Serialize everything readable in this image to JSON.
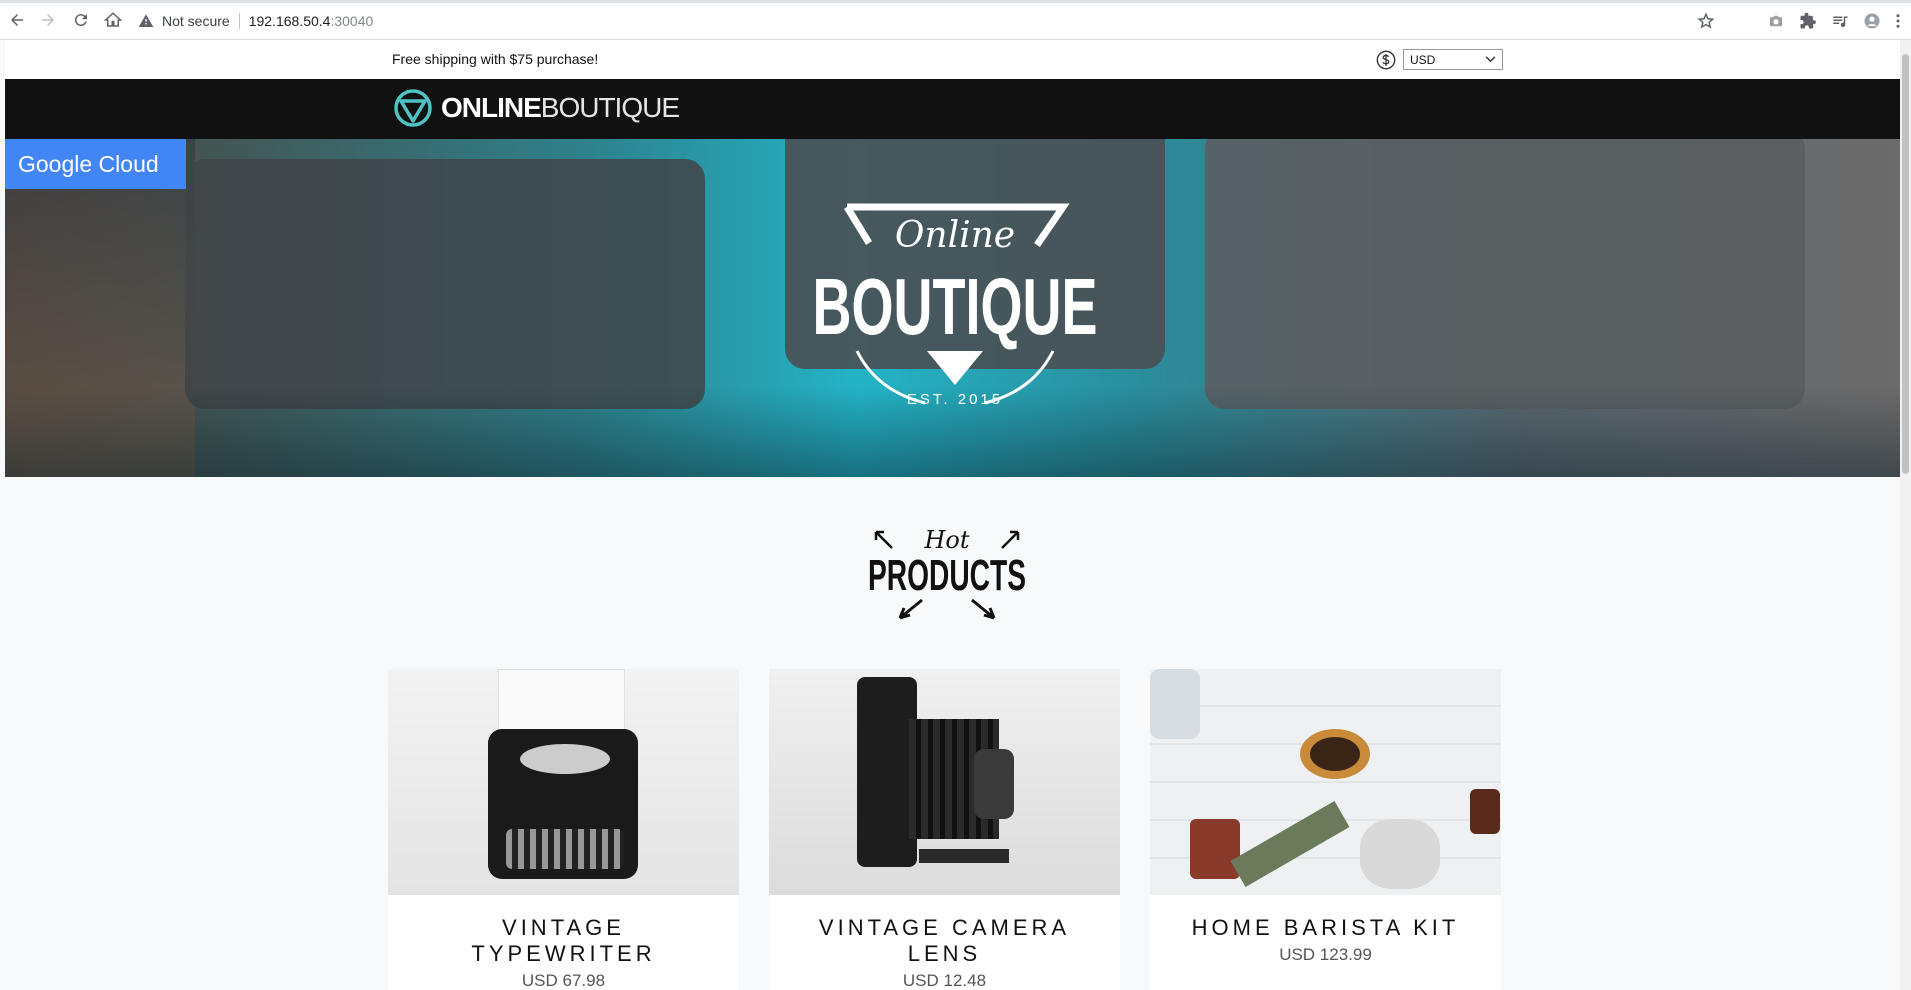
{
  "browser": {
    "security_label": "Not secure",
    "url_host": "192.168.50.4",
    "url_port": ":30040"
  },
  "topbar": {
    "shipping_message": "Free shipping with $75 purchase!",
    "currency_selected": "USD"
  },
  "header": {
    "logo_bold": "ONLINE",
    "logo_light": "BOUTIQUE"
  },
  "hero": {
    "badge": "Google Cloud",
    "logo_script": "Online",
    "logo_main": "BOUTIQUE",
    "logo_est": "EST. 2015"
  },
  "section": {
    "hot_script": "Hot",
    "hot_main": "PRODUCTS"
  },
  "products": [
    {
      "name": "VINTAGE TYPEWRITER",
      "price": "USD 67.98"
    },
    {
      "name": "VINTAGE CAMERA LENS",
      "price": "USD 12.48"
    },
    {
      "name": "HOME BARISTA KIT",
      "price": "USD 123.99"
    }
  ],
  "colors": {
    "accent_blue": "#4285f4",
    "header_black": "#111111",
    "logo_teal": "#4fc3c3"
  }
}
